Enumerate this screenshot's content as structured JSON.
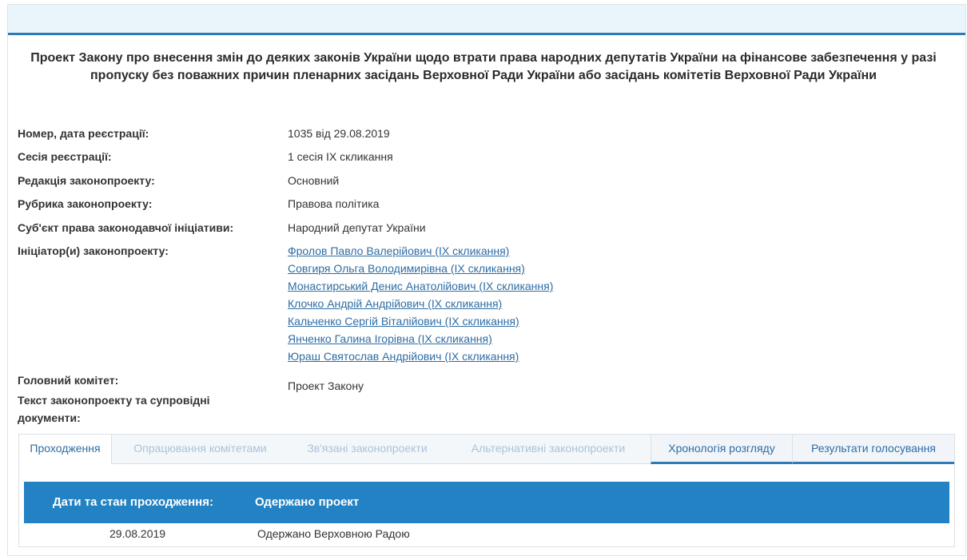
{
  "title": "Проект Закону про внесення змін до деяких законів України щодо втрати права народних депутатів України на фінансове забезпечення у разі пропуску без поважних причин пленарних засідань Верховної Ради України або засідань комітетів Верховної Ради України",
  "fields": {
    "number": {
      "label": "Номер, дата реєстрації:",
      "value": "1035 від 29.08.2019"
    },
    "session": {
      "label": "Сесія реєстрації:",
      "value": "1 сесія IX скликання"
    },
    "edition": {
      "label": "Редакція законопроекту:",
      "value": "Основний"
    },
    "rubric": {
      "label": "Рубрика законопроекту:",
      "value": "Правова політика"
    },
    "subject": {
      "label": "Суб'єкт права законодавчої ініціативи:",
      "value": "Народний депутат України"
    },
    "initiators": {
      "label": "Ініціатор(и) законопроекту:",
      "items": [
        "Фролов Павло Валерійович (IX скликання)",
        "Совгиря Ольга Володимирівна (IX скликання)",
        "Монастирський Денис Анатолійович (IX скликання)",
        "Клочко Андрій Андрійович (IX скликання)",
        "Кальченко Сергій Віталійович (IX скликання)",
        "Янченко Галина Ігорівна (IX скликання)",
        "Юраш Святослав Андрійович (IX скликання)"
      ]
    },
    "committee": {
      "label": "Головний комітет:"
    },
    "documents": {
      "label": "Текст законопроекту та супровідні документи:",
      "value": "Проект Закону"
    }
  },
  "tabs": [
    {
      "label": "Проходження",
      "state": "active"
    },
    {
      "label": "Опрацювання комітетами",
      "state": "disabled"
    },
    {
      "label": "Зв'язані законопроекти",
      "state": "disabled"
    },
    {
      "label": "Альтернативні законопроекти",
      "state": "disabled"
    },
    {
      "label": "Хронологія розгляду",
      "state": "enabled"
    },
    {
      "label": "Результати голосування",
      "state": "enabled"
    }
  ],
  "table": {
    "header": {
      "col1": "Дати та стан проходження:",
      "col2": "Одержано проект"
    },
    "rows": [
      {
        "date": "29.08.2019",
        "status": "Одержано Верховною Радою"
      }
    ]
  }
}
